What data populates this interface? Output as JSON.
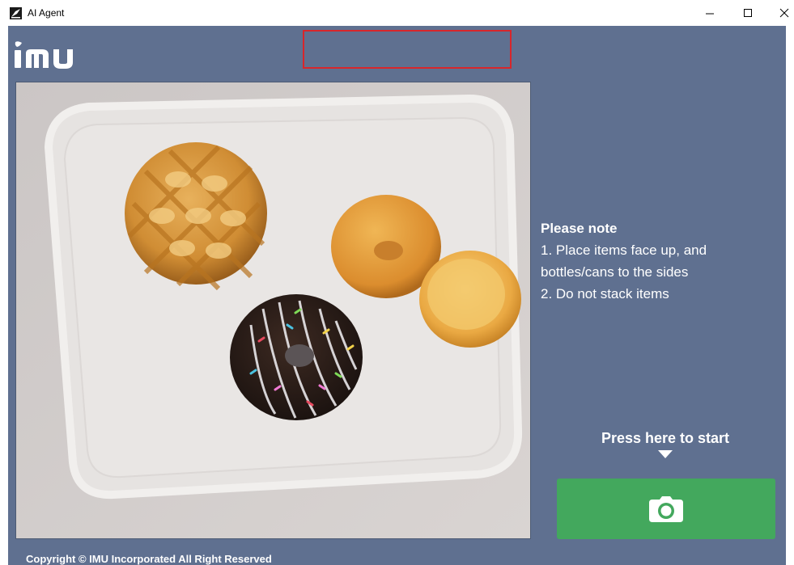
{
  "window": {
    "title": "AI Agent"
  },
  "notes": {
    "title": "Please note",
    "items": [
      "1. Place items face up, and",
      "bottles/cans to the sides",
      "2. Do not stack items"
    ]
  },
  "start": {
    "label": "Press here to start",
    "button_icon": "camera-icon"
  },
  "footer": {
    "copyright": "Copyright © IMU Incorporated All Right Reserved"
  },
  "icons": {
    "app": "app-icon",
    "minimize": "minimize-icon",
    "maximize": "maximize-icon",
    "close": "close-icon"
  },
  "colors": {
    "app_background": "#5f7090",
    "start_button": "#43a85d",
    "status_box_border": "#d8262b"
  }
}
